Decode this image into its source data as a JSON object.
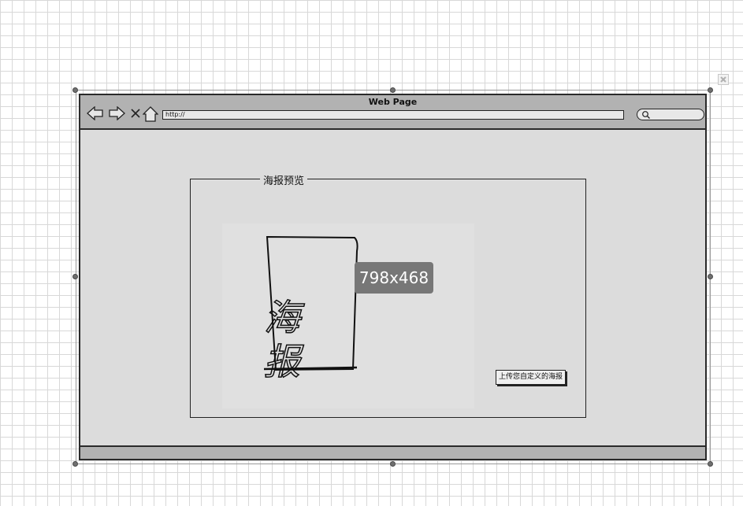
{
  "browser": {
    "title": "Web Page",
    "url": "http://"
  },
  "preview": {
    "group_label": "海报预览",
    "poster_text": "海报",
    "size_label": "798x468",
    "upload_button_label": "上传您自定义的海报"
  },
  "icons": [
    "back-arrow-icon",
    "forward-arrow-icon",
    "close-x-icon",
    "home-icon",
    "search-icon",
    "canvas-close-icon"
  ]
}
